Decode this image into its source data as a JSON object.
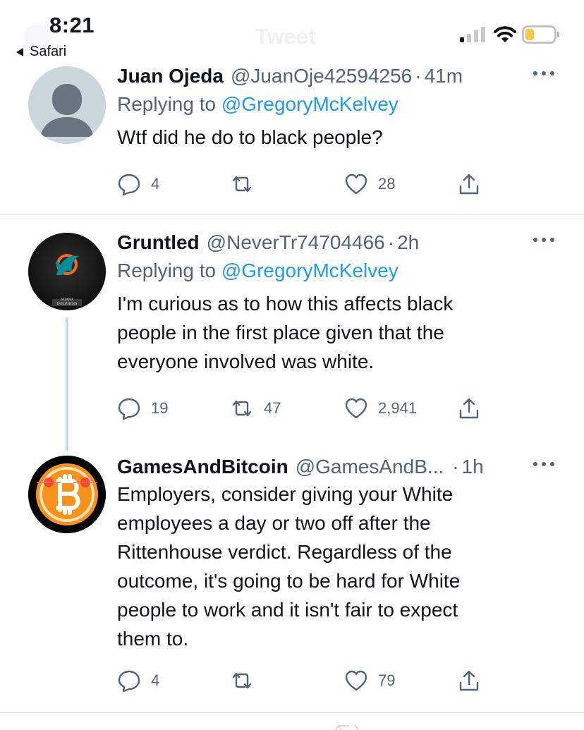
{
  "status_bar": {
    "time": "8:21",
    "back_app": "Safari",
    "page_title": "Tweet"
  },
  "tweets": [
    {
      "name": "Juan Ojeda",
      "handle": "@JuanOje42594256",
      "separator": "·",
      "time": "41m",
      "replying_prefix": "Replying to",
      "replying_to": "@GregoryMcKelvey",
      "text": "Wtf did he do to black people?",
      "replies": "4",
      "retweets": "",
      "likes": "28",
      "avatar": "default-avatar"
    },
    {
      "name": "Gruntled",
      "handle": "@NeverTr74704466",
      "separator": "·",
      "time": "2h",
      "replying_prefix": "Replying to",
      "replying_to": "@GregoryMcKelvey",
      "text_lines": [
        "I'm curious as to how this affects black",
        "people in the first place given that the",
        "everyone involved was white."
      ],
      "replies": "19",
      "retweets": "47",
      "likes": "2,941",
      "avatar": "miami-dolphins-logo",
      "avatar_caption": "MIAMI DOLPHINS"
    },
    {
      "name": "GamesAndBitcoin",
      "handle": "@GamesAndB...",
      "separator": "·",
      "time": "1h",
      "text_lines": [
        "Employers, consider giving your White",
        "employees a day or two off after the",
        "Rittenhouse verdict. Regardless of the",
        "outcome, it's going to be hard for White",
        "people to work and it isn't fair to expect",
        "them to."
      ],
      "replies": "4",
      "retweets": "",
      "likes": "79",
      "avatar": "bitcoin-logo"
    }
  ],
  "colors": {
    "accent": "#1d9bf0",
    "muted": "#536471",
    "text": "#0f1419",
    "battery_level": "#f7c948",
    "bitcoin": "#f7931a"
  }
}
